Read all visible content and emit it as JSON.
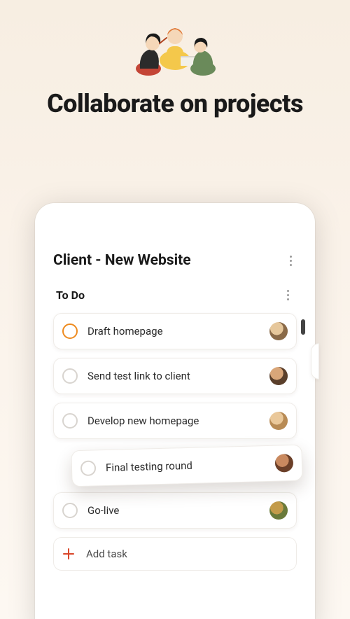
{
  "headline": "Collaborate on projects",
  "project": {
    "title": "Client - New Website"
  },
  "column": {
    "title": "To Do"
  },
  "tasks": [
    {
      "label": "Draft homepage",
      "accent": true
    },
    {
      "label": "Send test link to client"
    },
    {
      "label": "Develop new homepage"
    },
    {
      "label": "Final testing round",
      "floating": true
    },
    {
      "label": "Go-live"
    }
  ],
  "add_task_label": "Add task",
  "colors": {
    "accent_orange": "#ee8b1f",
    "plus_red": "#d9472a"
  }
}
